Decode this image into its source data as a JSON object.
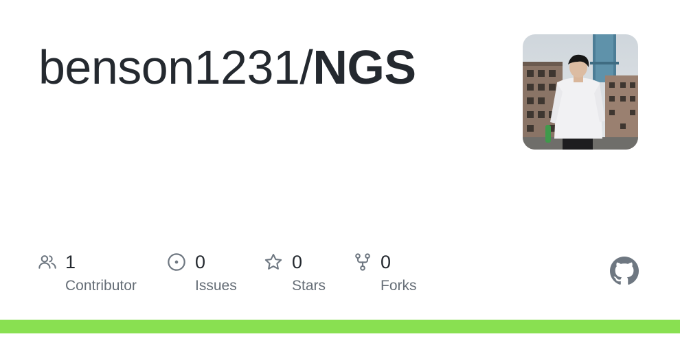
{
  "repo": {
    "owner": "benson1231/",
    "name": "NGS"
  },
  "avatar": {
    "alt_icon": "user-avatar"
  },
  "stats": {
    "contributors": {
      "count": "1",
      "label": "Contributor",
      "icon": "people-icon"
    },
    "issues": {
      "count": "0",
      "label": "Issues",
      "icon": "issue-opened-icon"
    },
    "stars": {
      "count": "0",
      "label": "Stars",
      "icon": "star-icon"
    },
    "forks": {
      "count": "0",
      "label": "Forks",
      "icon": "repo-forked-icon"
    }
  },
  "colors": {
    "text": "#24292f",
    "muted": "#656d76",
    "icon": "#6e7781",
    "language_bar": "#89e051"
  }
}
